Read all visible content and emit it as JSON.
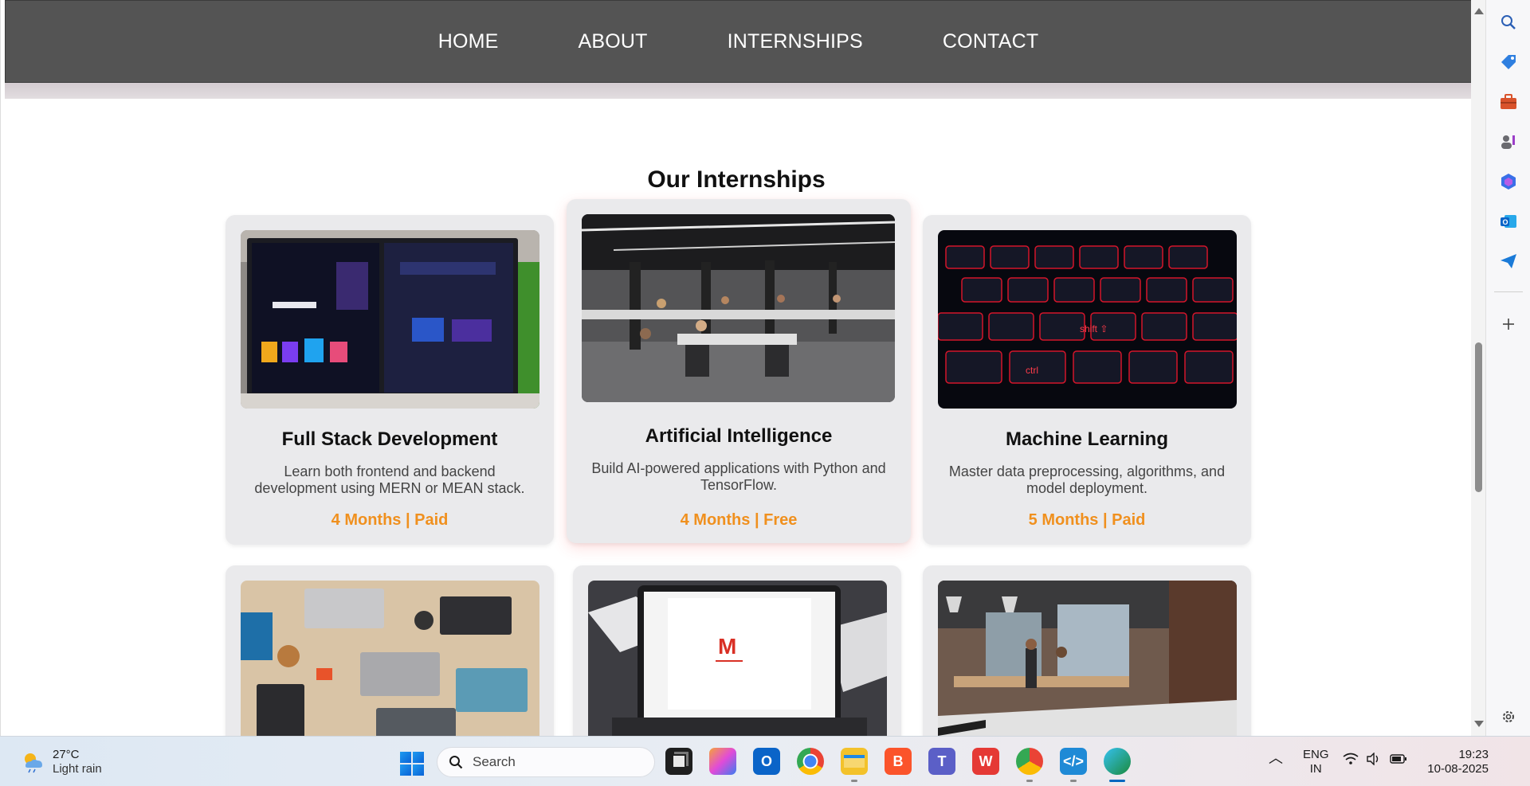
{
  "nav": {
    "links": [
      "HOME",
      "ABOUT",
      "INTERNSHIPS",
      "CONTACT"
    ]
  },
  "section": {
    "title": "Our Internships"
  },
  "cards": [
    {
      "title": "Full Stack Development",
      "desc": "Learn both frontend and backend development using MERN or MEAN stack.",
      "meta": "4 Months | Paid",
      "image": "monitor-web-design-photo"
    },
    {
      "title": "Artificial Intelligence",
      "desc": "Build AI-powered applications with Python and TensorFlow.",
      "meta": "4 Months | Free",
      "image": "open-office-people-photo"
    },
    {
      "title": "Machine Learning",
      "desc": "Master data preprocessing, algorithms, and model deployment.",
      "meta": "5 Months | Paid",
      "image": "red-backlit-keyboard-photo"
    },
    {
      "image": "laptops-on-table-photo"
    },
    {
      "image": "laptop-gmail-photo"
    },
    {
      "image": "loft-office-photo"
    }
  ],
  "colors": {
    "navbar": "#545454",
    "card_bg": "#eaeaec",
    "accent": "#f0901e"
  },
  "sidebar": {
    "icons": [
      "search-icon",
      "tag-icon",
      "toolbox-icon",
      "people-icon",
      "copilot-icon",
      "outlook-icon",
      "send-icon",
      "add-icon",
      "settings-icon"
    ]
  },
  "taskbar": {
    "weather": {
      "temp": "27°C",
      "condition": "Light rain"
    },
    "search_placeholder": "Search",
    "apps": [
      "task-view",
      "copilot",
      "outlook",
      "chrome",
      "file-explorer",
      "brave",
      "teams",
      "wps-office",
      "chrome-beta",
      "vscode",
      "edge"
    ],
    "tray": {
      "lang_top": "ENG",
      "lang_bottom": "IN",
      "time": "19:23",
      "date": "10-08-2025"
    }
  }
}
